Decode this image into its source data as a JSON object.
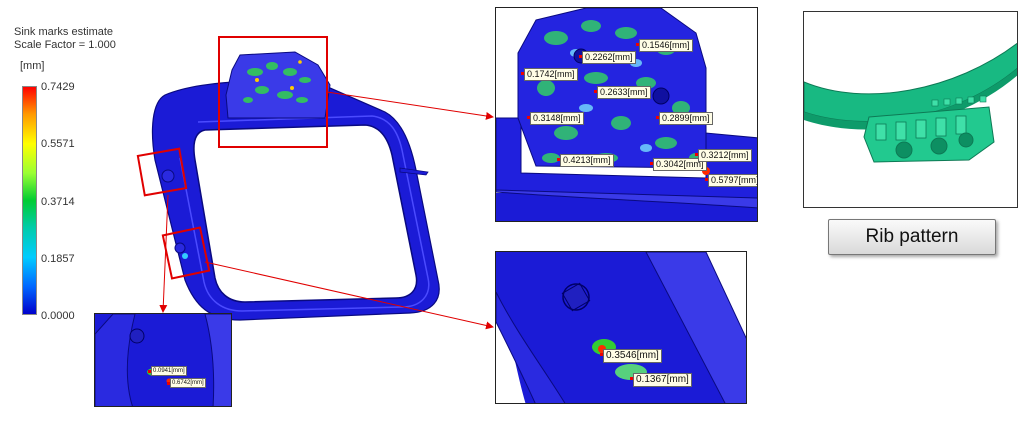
{
  "legend": {
    "title_line1": "Sink marks estimate",
    "title_line2": "Scale Factor = 1.000",
    "unit": "[mm]",
    "ticks": [
      "0.7429",
      "0.5571",
      "0.3714",
      "0.1857",
      "0.0000"
    ],
    "range_max": 0.7429,
    "range_min": 0.0
  },
  "top_inset_labels": [
    "0.1546[mm]",
    "0.2262[mm]",
    "0.1742[mm]",
    "0.2633[mm]",
    "0.3148[mm]",
    "0.2899[mm]",
    "0.4213[mm]",
    "0.3042[mm]",
    "0.3212[mm]",
    "0.5797[mm]"
  ],
  "bottom_right_labels": [
    "0.3546[mm]",
    "0.1367[mm]"
  ],
  "bottom_left_labels": [
    "0.0941[mm]",
    "0.6742[mm]"
  ],
  "rib_button_label": "Rib pattern",
  "colors": {
    "part": "#1a1ae6",
    "callout": "#e00000",
    "hot": "#ff2a00",
    "green": "#33cc33"
  }
}
